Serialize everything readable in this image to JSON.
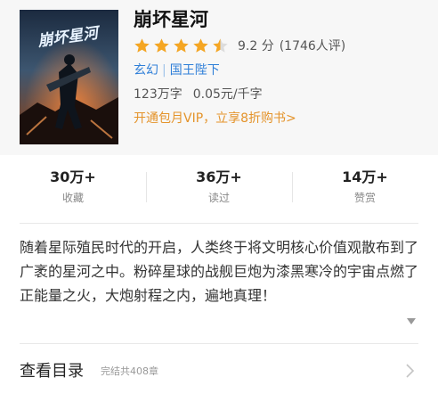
{
  "book": {
    "title": "崩坏星河",
    "cover_text": "崩坏星河",
    "rating": {
      "score_text": "9.2 分",
      "stars_filled": 4.5,
      "stars_total": 5,
      "count_text": "(1746人评)"
    },
    "tags": {
      "genre": "玄幻",
      "separator": "|",
      "author": "国王陛下"
    },
    "word_count": "123万字",
    "price": "0.05元/千字",
    "vip_promo": "开通包月VIP，立享8折购书>"
  },
  "stats": [
    {
      "value": "30万+",
      "label": "收藏"
    },
    {
      "value": "36万+",
      "label": "读过"
    },
    {
      "value": "14万+",
      "label": "赞赏"
    }
  ],
  "description": "随着星际殖民时代的开启，人类终于将文明核心价值观散布到了广袤的星河之中。粉碎星球的战舰巨炮为漆黑寒冷的宇宙点燃了正能量之火，大炮射程之内，遍地真理！",
  "toc": {
    "title": "查看目录",
    "subtitle": "完结共408章"
  },
  "icons": {
    "star": "star-icon",
    "expand": "chevron-down-icon",
    "toc_arrow": "chevron-right-icon"
  },
  "colors": {
    "star": "#f5a623",
    "link": "#2f7fd8",
    "promo": "#e4932a"
  }
}
